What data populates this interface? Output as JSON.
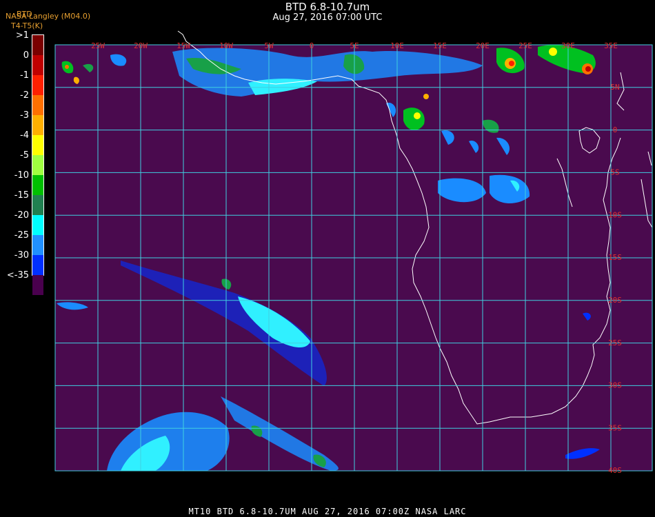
{
  "header": {
    "title": "BTD 6.8-10.7um",
    "datetime": "Aug 27, 2016 07:00 UTC",
    "credit": "NASA Langley (M04.0)",
    "product": "BTD",
    "units": "T4-T5(K)"
  },
  "colorbar": {
    "labels": [
      ">1",
      "0",
      "-1",
      "-2",
      "-3",
      "-4",
      "-5",
      "-10",
      "-15",
      "-20",
      "-25",
      "-30",
      "<-35"
    ],
    "colors": [
      "#7a0000",
      "#c00000",
      "#ff2000",
      "#ff7000",
      "#ffb000",
      "#ffff00",
      "#a0ff40",
      "#00c000",
      "#208050",
      "#00ffff",
      "#2090ff",
      "#0030ff",
      "#4a004e"
    ]
  },
  "map": {
    "background": "#4a0a4e",
    "grid_color": "#40d0e0",
    "coast_color": "#ffffff",
    "lon_labels": [
      "25W",
      "20W",
      "15W",
      "10W",
      "5W",
      "0",
      "5E",
      "10E",
      "15E",
      "20E",
      "25E",
      "30E",
      "35E"
    ],
    "lat_labels": [
      "5N",
      "0",
      "5S",
      "10S",
      "15S",
      "20S",
      "25S",
      "30S",
      "35S",
      "40S"
    ]
  },
  "footer": "MT10   BTD 6.8-10.7UM   AUG 27, 2016 07:00Z   NASA LARC"
}
